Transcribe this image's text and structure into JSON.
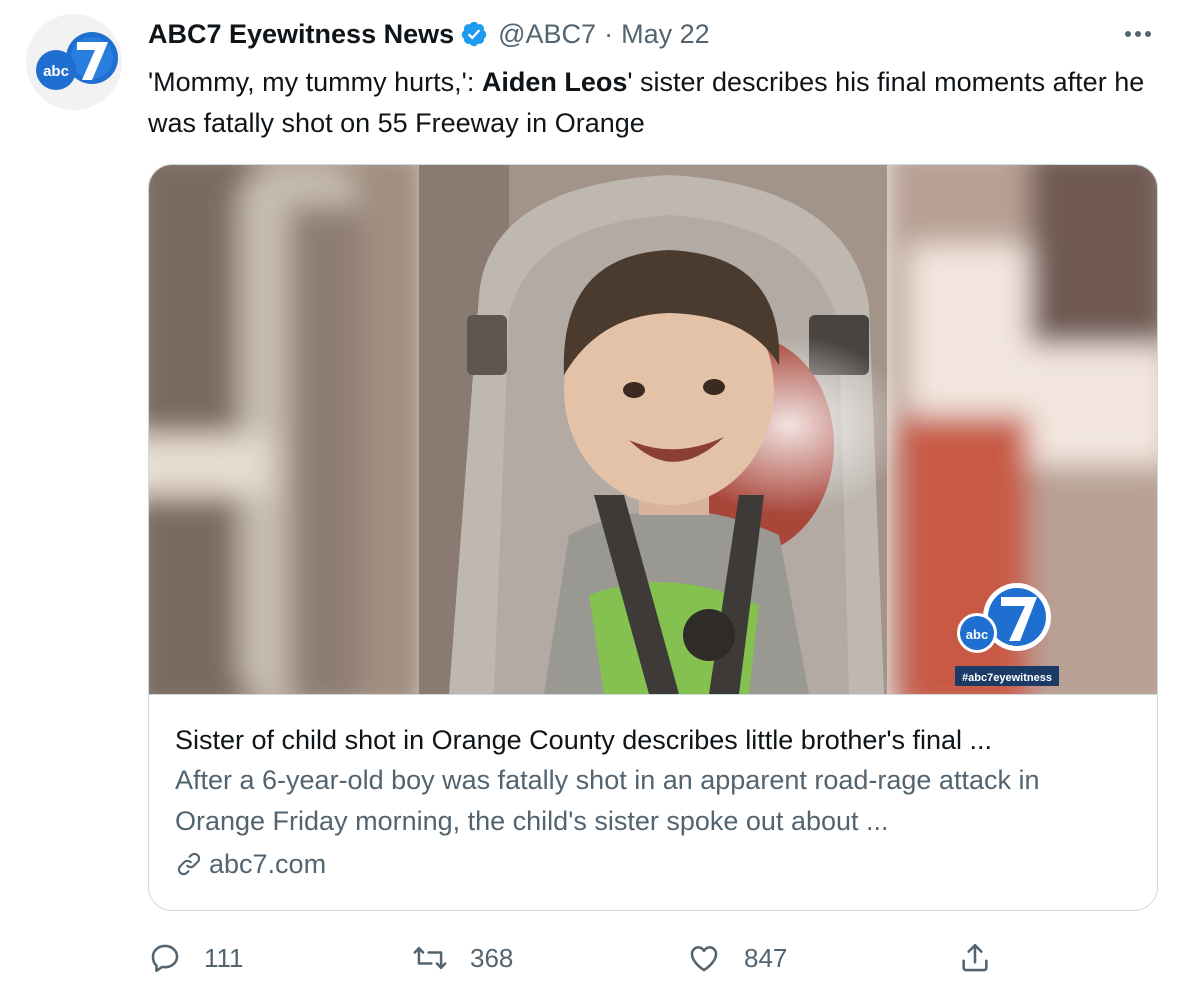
{
  "author": {
    "name": "ABC7 Eyewitness News",
    "handle": "@ABC7",
    "separator": "·",
    "date": "May 22",
    "avatar_icon": "abc7-logo",
    "verified_icon": "verified-badge-icon",
    "verified_color": "#1d9bf0"
  },
  "tweet": {
    "text_before": "'Mommy, my tummy hurts,': ",
    "text_bold": "Aiden Leos",
    "text_after": "' sister describes his final moments after he was fatally shot on 55 Freeway in Orange"
  },
  "card": {
    "image_watermark_hashtag": "#abc7eyewitness",
    "title": "Sister of child shot in Orange County describes little brother's final ...",
    "description": "After a 6-year-old boy was fatally shot in an apparent road-rage attack in Orange Friday morning, the child's sister spoke out about ...",
    "domain": "abc7.com"
  },
  "actions": {
    "reply_count": "111",
    "retweet_count": "368",
    "like_count": "847"
  },
  "colors": {
    "text_primary": "#0f1419",
    "text_secondary": "#536471",
    "border": "#cfd9de",
    "abc_blue": "#1f6fd0"
  }
}
